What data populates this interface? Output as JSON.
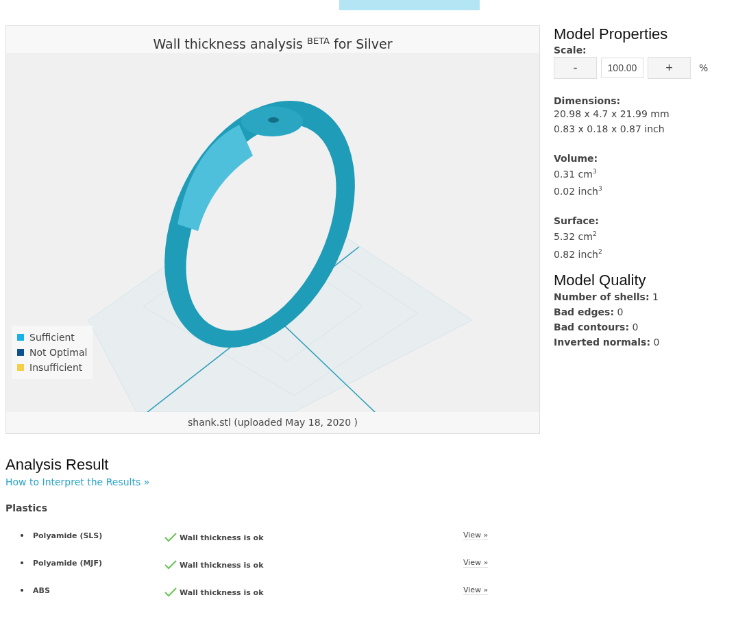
{
  "viewer": {
    "title": "Wall thickness analysis $^{BETA}$ for Silver",
    "legend": [
      {
        "label": "Sufficient",
        "color": "#1ab0e8"
      },
      {
        "label": "Not Optimal",
        "color": "#0d4f8f"
      },
      {
        "label": "Insufficient",
        "color": "#f5cf47"
      }
    ],
    "file_caption": "shank.stl (uploaded May 18, 2020 )"
  },
  "model_properties": {
    "title": "Model Properties",
    "scale": {
      "label": "Scale:",
      "minus": "-",
      "value": "100.00",
      "plus": "+",
      "unit": "%"
    },
    "groups": [
      {
        "label": "Dimensions:",
        "lines": [
          "20.98 x 4.7 x 21.99 mm",
          "0.83 x 0.18 x 0.87 inch"
        ]
      },
      {
        "label": "Volume:",
        "lines": [
          "0.31 cm$^{3}$",
          "0.02 inch$^{3}$"
        ]
      },
      {
        "label": "Surface:",
        "lines": [
          "5.32 cm$^{2}$",
          "0.82 inch$^{2}$"
        ]
      }
    ]
  },
  "model_quality": {
    "title": "Model Quality",
    "items": [
      {
        "label": "Number of shells:",
        "value": "1"
      },
      {
        "label": "Bad edges:",
        "value": "0"
      },
      {
        "label": "Bad contours:",
        "value": "0"
      },
      {
        "label": "Inverted normals:",
        "value": "0"
      }
    ]
  },
  "analysis": {
    "title": "Analysis Result",
    "link": "How to Interpret the Results »",
    "category": "Plastics",
    "rows": [
      {
        "material": "Polyamide (SLS)",
        "ok": true,
        "status": "Wall thickness is ok",
        "action": "View »"
      },
      {
        "material": "Polyamide (MJF)",
        "ok": true,
        "status": "Wall thickness is ok",
        "action": "View »"
      },
      {
        "material": "ABS",
        "ok": true,
        "status": "Wall thickness is ok",
        "action": "View »"
      }
    ]
  }
}
